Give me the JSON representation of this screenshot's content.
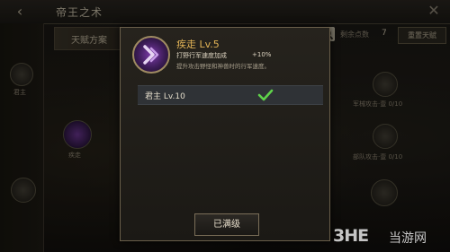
{
  "window": {
    "title": "帝王之术",
    "back_glyph": "‹",
    "close_glyph": "✕"
  },
  "background": {
    "tab_label": "天赋方案",
    "left_items": [
      "君主",
      "疾走"
    ],
    "right_items": [
      "军械攻击·壹 0/10",
      "部队攻击·壹 0/10"
    ],
    "points_label": "剩余点数",
    "points_value": "7",
    "reset_label": "重置天赋"
  },
  "modal": {
    "skill_icon": "sprint-arrows-icon",
    "title": "疾走 Lv.5",
    "effect_label": "打野行军速度加成",
    "effect_value": "+10%",
    "description": "提升攻击野怪和神兽时的行军速度。",
    "requirement": "君主 Lv.10",
    "requirement_met": true,
    "button_label": "已满级"
  },
  "watermark": {
    "logo": "3HE",
    "text": "当游网"
  },
  "colors": {
    "title_gold": "#e0b255",
    "check_green": "#5fd24a",
    "purple": "#7b3aa8"
  }
}
